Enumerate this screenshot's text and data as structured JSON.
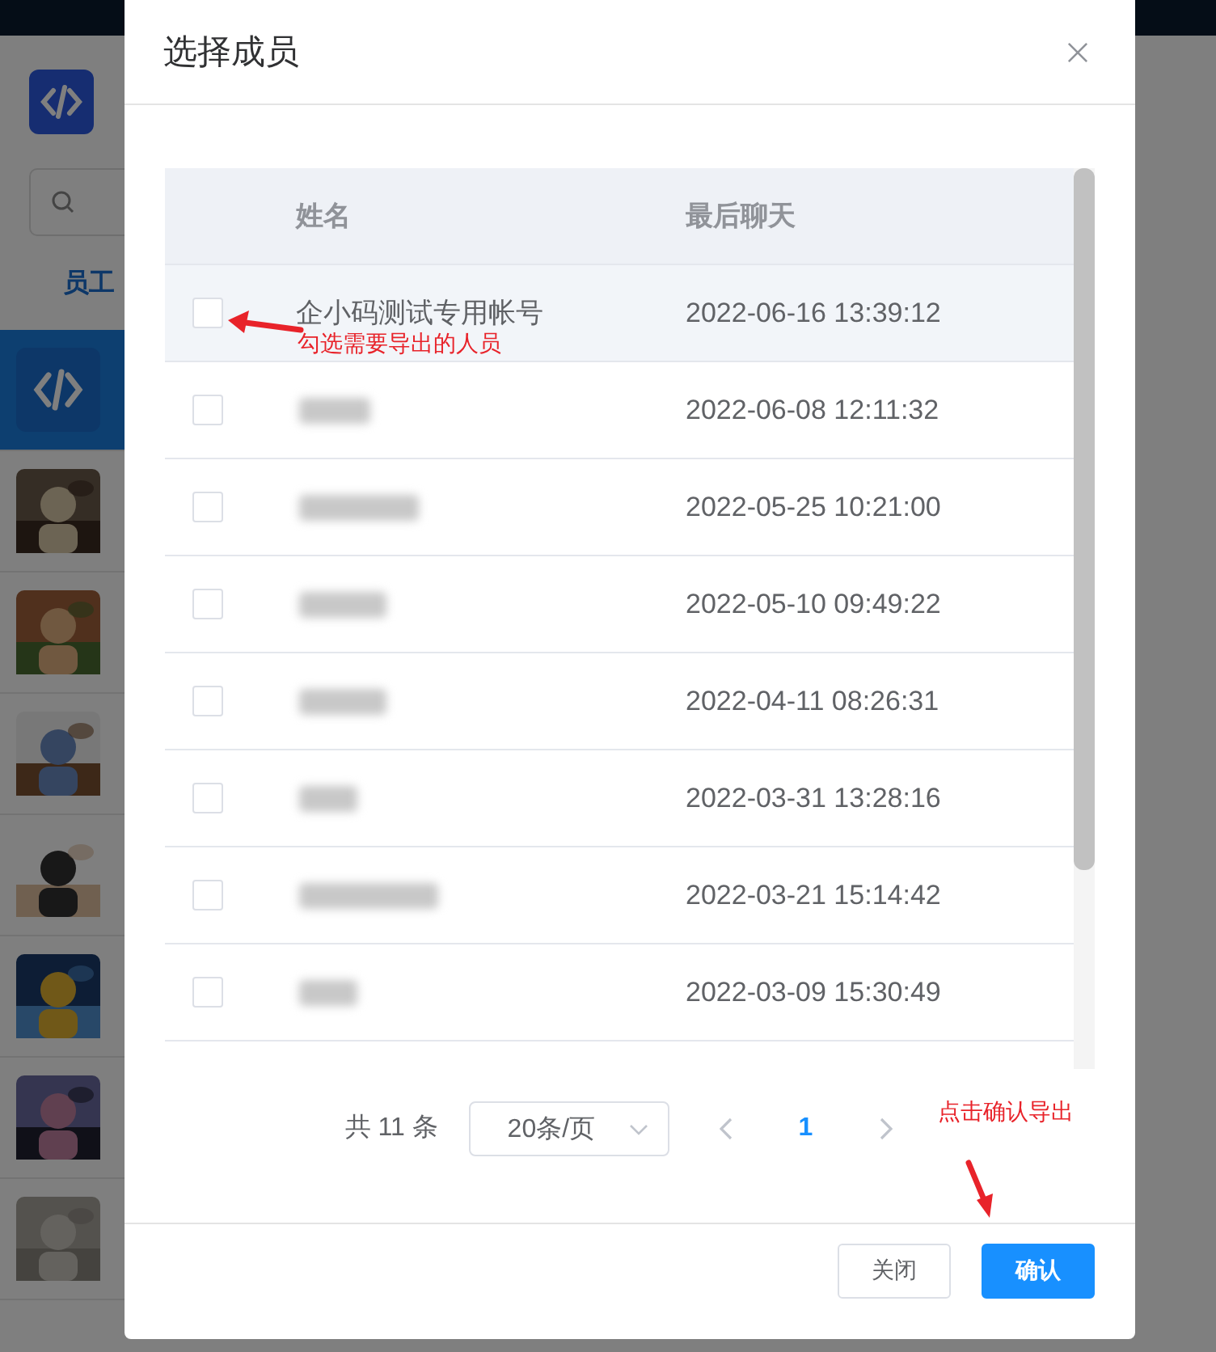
{
  "background": {
    "tab": "员工",
    "contacts": [
      {
        "kind": "logo",
        "selected": true
      },
      {
        "kind": "picture",
        "selected": false
      },
      {
        "kind": "picture",
        "selected": false
      },
      {
        "kind": "picture",
        "selected": false
      },
      {
        "kind": "picture",
        "selected": false
      },
      {
        "kind": "picture",
        "selected": false
      },
      {
        "kind": "picture",
        "selected": false
      },
      {
        "kind": "picture",
        "selected": false
      }
    ]
  },
  "dialog": {
    "title": "选择成员",
    "columns": [
      "姓名",
      "最后聊天"
    ],
    "rows": [
      {
        "name": "企小码测试专用帐号",
        "redacted": false,
        "last_chat": "2022-06-16 13:39:12",
        "checked": false,
        "hovered": true
      },
      {
        "redacted": true,
        "last_chat": "2022-06-08 12:11:32",
        "checked": false,
        "hovered": false
      },
      {
        "redacted": true,
        "last_chat": "2022-05-25 10:21:00",
        "checked": false,
        "hovered": false
      },
      {
        "redacted": true,
        "last_chat": "2022-05-10 09:49:22",
        "checked": false,
        "hovered": false
      },
      {
        "redacted": true,
        "last_chat": "2022-04-11 08:26:31",
        "checked": false,
        "hovered": false
      },
      {
        "redacted": true,
        "last_chat": "2022-03-31 13:28:16",
        "checked": false,
        "hovered": false
      },
      {
        "redacted": true,
        "last_chat": "2022-03-21 15:14:42",
        "checked": false,
        "hovered": false
      },
      {
        "redacted": true,
        "last_chat": "2022-03-09 15:30:49",
        "checked": false,
        "hovered": false
      }
    ],
    "pagination": {
      "total": "共 11 条",
      "page_size": "20条/页",
      "pages": [
        {
          "label": "1",
          "selected": true
        }
      ]
    },
    "buttons": [
      {
        "label": "关闭",
        "kind": "default"
      },
      {
        "label": "确认",
        "kind": "primary"
      }
    ]
  },
  "annotations": [
    {
      "text": "勾选需要导出的人员",
      "kind": "checkbox-hint"
    },
    {
      "text": "点击确认导出",
      "kind": "confirm-hint"
    }
  ]
}
